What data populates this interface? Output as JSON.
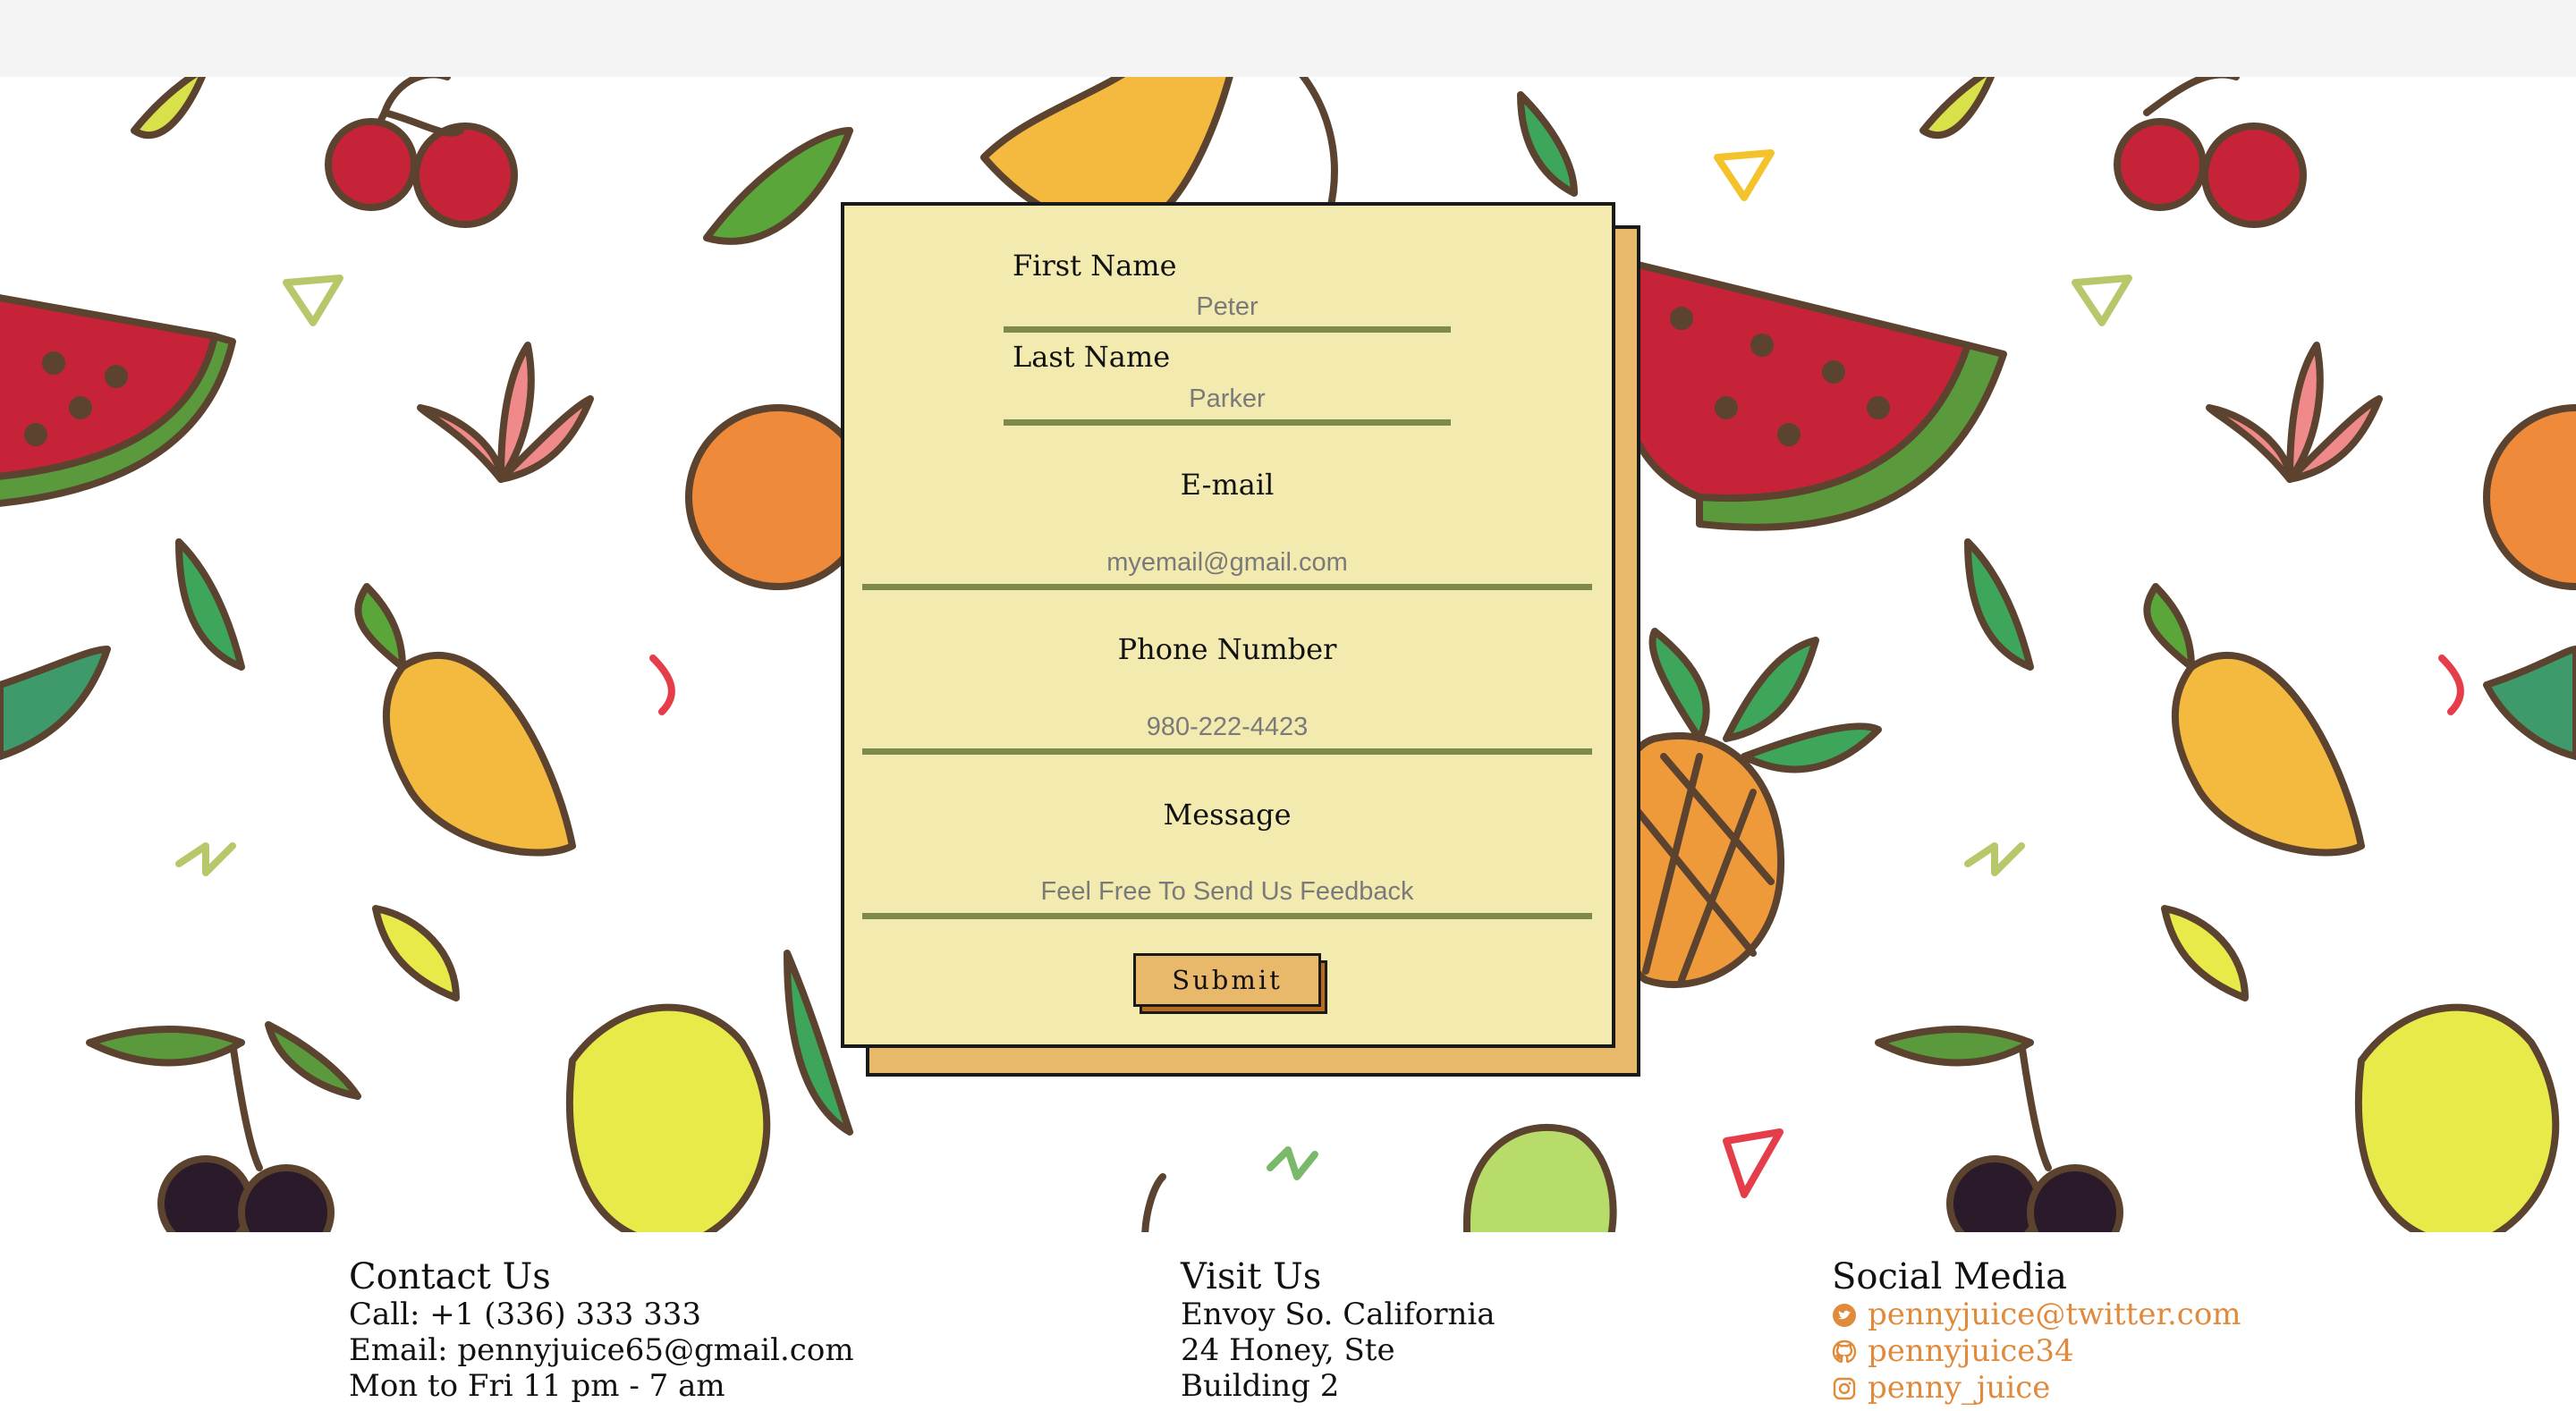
{
  "form": {
    "first_name_label": "First Name",
    "first_name_placeholder": "Peter",
    "last_name_label": "Last Name",
    "last_name_placeholder": "Parker",
    "email_label": "E-mail",
    "email_placeholder": "myemail@gmail.com",
    "phone_label": "Phone Number",
    "phone_placeholder": "980-222-4423",
    "message_label": "Message",
    "message_placeholder": "Feel Free To Send Us Feedback",
    "submit_label": "Submit"
  },
  "footer": {
    "contact": {
      "title": "Contact Us",
      "call": "Call: +1 (336) 333 333",
      "email": "Email: pennyjuice65@gmail.com",
      "hours": "Mon to Fri 11 pm - 7 am"
    },
    "visit": {
      "title": "Visit Us",
      "line1": "Envoy So. California",
      "line2": "24 Honey, Ste",
      "line3": "Building 2"
    },
    "social": {
      "title": "Social Media",
      "twitter": "pennyjuice@twitter.com",
      "github": "pennyjuice34",
      "instagram": "penny_juice"
    }
  },
  "icons": {
    "twitter": "twitter-icon",
    "github": "github-icon",
    "instagram": "instagram-icon"
  },
  "colors": {
    "card_bg": "#f2eaae",
    "card_shadow": "#e8b96a",
    "underline": "#7e8a4a",
    "link": "#e08a3c"
  }
}
